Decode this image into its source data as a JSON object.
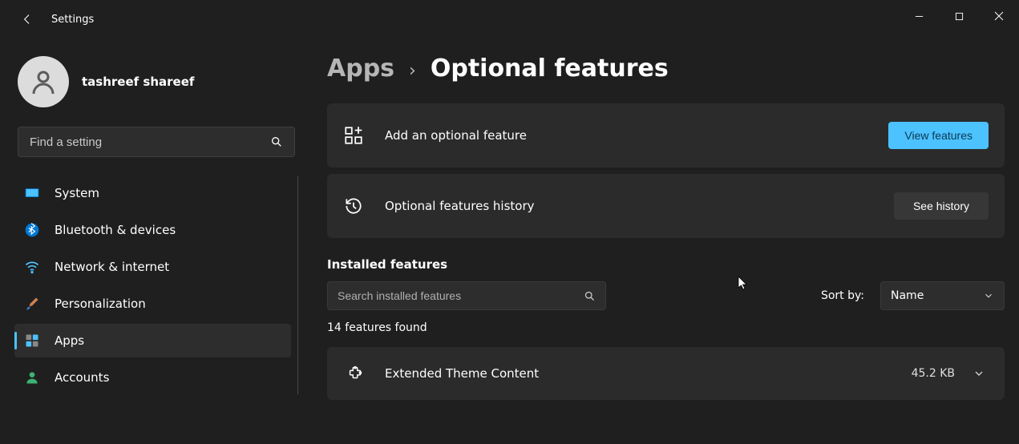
{
  "window": {
    "app_title": "Settings"
  },
  "profile": {
    "name": "tashreef shareef"
  },
  "sidebar": {
    "search_placeholder": "Find a setting",
    "items": [
      {
        "label": "System"
      },
      {
        "label": "Bluetooth & devices"
      },
      {
        "label": "Network & internet"
      },
      {
        "label": "Personalization"
      },
      {
        "label": "Apps"
      },
      {
        "label": "Accounts"
      }
    ],
    "active_index": 4
  },
  "breadcrumb": {
    "parent": "Apps",
    "current": "Optional features"
  },
  "cards": {
    "add": {
      "title": "Add an optional feature",
      "button": "View features"
    },
    "history": {
      "title": "Optional features history",
      "button": "See history"
    }
  },
  "installed": {
    "section_label": "Installed features",
    "search_placeholder": "Search installed features",
    "sort_label": "Sort by:",
    "sort_value": "Name",
    "count_text": "14 features found",
    "features": [
      {
        "name": "Extended Theme Content",
        "size": "45.2 KB"
      }
    ]
  },
  "colors": {
    "accent": "#4cc2ff"
  }
}
